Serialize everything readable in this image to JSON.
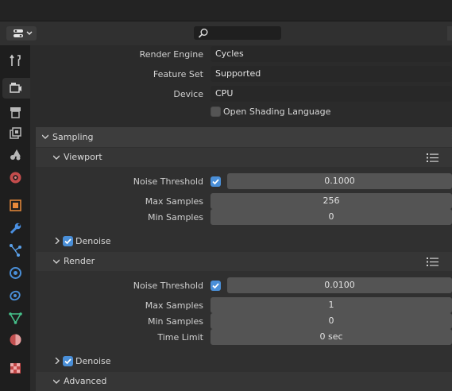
{
  "render": {
    "engine_label": "Render Engine",
    "engine_value": "Cycles",
    "feature_label": "Feature Set",
    "feature_value": "Supported",
    "device_label": "Device",
    "device_value": "CPU",
    "osl_label": "Open Shading Language",
    "osl_checked": false
  },
  "sampling": {
    "title": "Sampling",
    "viewport": {
      "title": "Viewport",
      "noise_label": "Noise Threshold",
      "noise_enabled": true,
      "noise_value": "0.1000",
      "max_label": "Max Samples",
      "max_value": "256",
      "min_label": "Min Samples",
      "min_value": "0",
      "denoise_label": "Denoise",
      "denoise_checked": true
    },
    "render": {
      "title": "Render",
      "noise_label": "Noise Threshold",
      "noise_enabled": true,
      "noise_value": "0.0100",
      "max_label": "Max Samples",
      "max_value": "1",
      "min_label": "Min Samples",
      "min_value": "0",
      "time_label": "Time Limit",
      "time_value": "0 sec",
      "denoise_label": "Denoise",
      "denoise_checked": true
    },
    "advanced": {
      "title": "Advanced"
    }
  },
  "icons": [
    "tool-icon",
    "render-icon",
    "output-icon",
    "view-layer-icon",
    "scene-icon",
    "world-icon",
    "object-icon",
    "modifier-icon",
    "particles-icon",
    "physics-icon",
    "constraints-icon",
    "data-icon",
    "material-icon",
    "texture-icon"
  ],
  "colors": {
    "accent": "#4a8fd8",
    "panel": "#3d3d3d",
    "background": "#2b2b2b"
  }
}
